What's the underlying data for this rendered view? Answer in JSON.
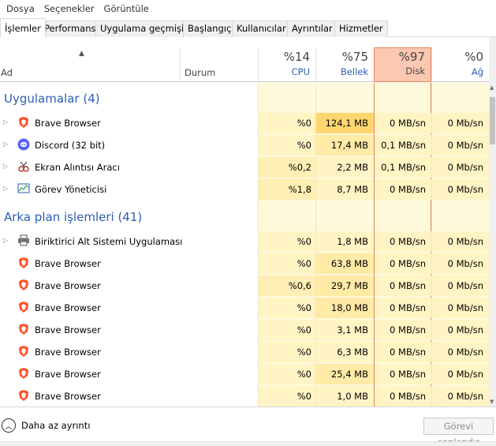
{
  "menu": [
    "Dosya",
    "Seçenekler",
    "Görüntüle"
  ],
  "tabs": [
    "İşlemler",
    "Performans",
    "Uygulama geçmişi",
    "Başlangıç",
    "Kullanıcılar",
    "Ayrıntılar",
    "Hizmetler"
  ],
  "active_tab": "İşlemler",
  "columns": {
    "name": "Ad",
    "status": "Durum",
    "cpu": {
      "percent": "%14",
      "label": "CPU"
    },
    "memory": {
      "percent": "%75",
      "label": "Bellek"
    },
    "disk": {
      "percent": "%97",
      "label": "Disk"
    },
    "network": {
      "percent": "%0",
      "label": "Ağ"
    }
  },
  "sections": {
    "apps": {
      "title": "Uygulamalar (4)",
      "rows": [
        {
          "name": "Brave Browser",
          "icon": "brave-icon",
          "cpu": "%0",
          "mem": "124,1 MB",
          "disk": "0 MB/sn",
          "net": "0 Mb/sn"
        },
        {
          "name": "Discord (32 bit)",
          "icon": "discord-icon",
          "cpu": "%0",
          "mem": "17,4 MB",
          "disk": "0,1 MB/sn",
          "net": "0 Mb/sn"
        },
        {
          "name": "Ekran Alıntısı Aracı",
          "icon": "snipping-tool-icon",
          "cpu": "%0,2",
          "mem": "2,2 MB",
          "disk": "0,1 MB/sn",
          "net": "0 Mb/sn"
        },
        {
          "name": "Görev Yöneticisi",
          "icon": "task-manager-icon",
          "cpu": "%1,8",
          "mem": "8,7 MB",
          "disk": "0 MB/sn",
          "net": "0 Mb/sn"
        }
      ]
    },
    "background": {
      "title": "Arka plan işlemleri (41)",
      "rows": [
        {
          "name": "Biriktirici Alt Sistemi Uygulaması",
          "icon": "printer-icon",
          "cpu": "%0",
          "mem": "1,8 MB",
          "disk": "0 MB/sn",
          "net": "0 Mb/sn"
        },
        {
          "name": "Brave Browser",
          "icon": "brave-icon",
          "cpu": "%0",
          "mem": "63,8 MB",
          "disk": "0 MB/sn",
          "net": "0 Mb/sn"
        },
        {
          "name": "Brave Browser",
          "icon": "brave-icon",
          "cpu": "%0,6",
          "mem": "29,7 MB",
          "disk": "0 MB/sn",
          "net": "0 Mb/sn"
        },
        {
          "name": "Brave Browser",
          "icon": "brave-icon",
          "cpu": "%0",
          "mem": "18,0 MB",
          "disk": "0 MB/sn",
          "net": "0 Mb/sn"
        },
        {
          "name": "Brave Browser",
          "icon": "brave-icon",
          "cpu": "%0",
          "mem": "3,1 MB",
          "disk": "0 MB/sn",
          "net": "0 Mb/sn"
        },
        {
          "name": "Brave Browser",
          "icon": "brave-icon",
          "cpu": "%0",
          "mem": "6,3 MB",
          "disk": "0 MB/sn",
          "net": "0 Mb/sn"
        },
        {
          "name": "Brave Browser",
          "icon": "brave-icon",
          "cpu": "%0",
          "mem": "25,4 MB",
          "disk": "0 MB/sn",
          "net": "0 Mb/sn"
        },
        {
          "name": "Brave Browser",
          "icon": "brave-icon",
          "cpu": "%0",
          "mem": "1,0 MB",
          "disk": "0 MB/sn",
          "net": "0 Mb/sn"
        }
      ]
    }
  },
  "footer": {
    "less_details": "Daha az ayrıntı",
    "end_task": "Görevi sonlandır"
  },
  "colors": {
    "accent_blue": "#2b5db3",
    "heat_light": "#fff4c4",
    "heat_medium": "#ffe9a0",
    "disk_header": "#fcc8b2"
  }
}
